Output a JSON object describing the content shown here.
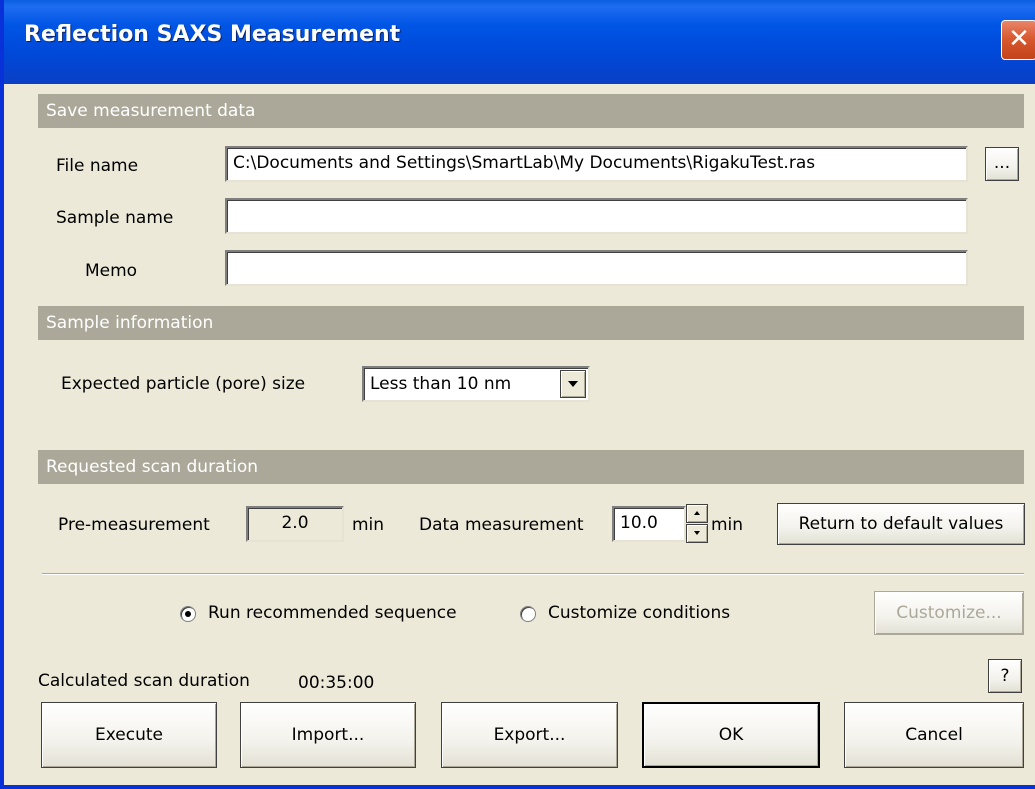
{
  "window": {
    "title": "Reflection SAXS Measurement",
    "close_glyph": "✕"
  },
  "save_section": {
    "header": "Save measurement data",
    "file_name_label": "File name",
    "file_name_value": "C:\\Documents and Settings\\SmartLab\\My Documents\\RigakuTest.ras",
    "browse_label": "...",
    "sample_name_label": "Sample name",
    "sample_name_value": "",
    "memo_label": "Memo",
    "memo_value": ""
  },
  "sample_section": {
    "header": "Sample information",
    "particle_size_label": "Expected particle (pore) size",
    "particle_size_value": "Less than 10 nm"
  },
  "scan_section": {
    "header": "Requested scan duration",
    "pre_label": "Pre-measurement",
    "pre_value": "2.0",
    "pre_unit": "min",
    "data_label": "Data measurement",
    "data_value": "10.0",
    "data_unit": "min",
    "default_button": "Return to default values"
  },
  "mode": {
    "recommended_label": "Run recommended sequence",
    "recommended_checked": true,
    "customize_label": "Customize conditions",
    "customize_checked": false,
    "customize_button": "Customize..."
  },
  "calc": {
    "label": "Calculated scan duration",
    "value": "00:35:00",
    "help_button": "?"
  },
  "buttons": {
    "execute": "Execute",
    "import": "Import...",
    "export": "Export...",
    "ok": "OK",
    "cancel": "Cancel"
  }
}
